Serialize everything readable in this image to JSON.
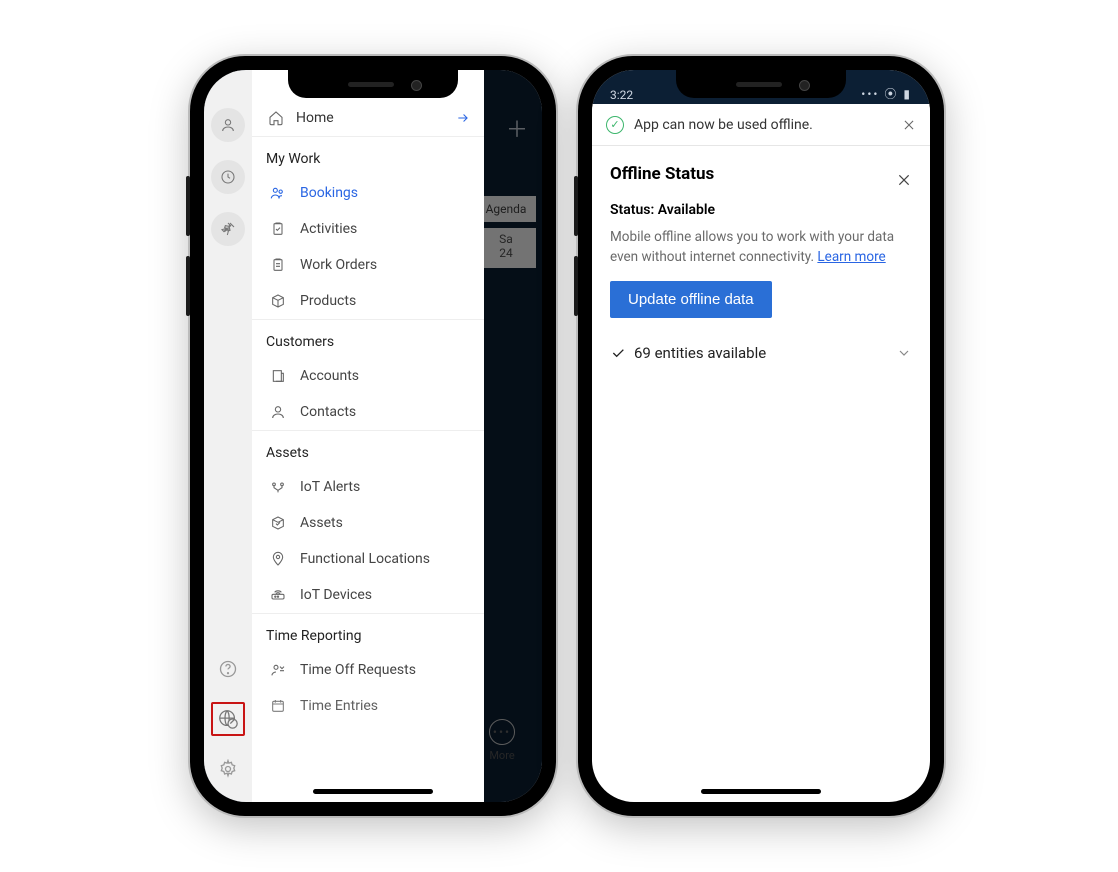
{
  "phone1": {
    "nav": {
      "home_label": "Home",
      "sections": {
        "mywork": {
          "title": "My Work",
          "items": [
            {
              "label": "Bookings",
              "selected": true,
              "icon": "people-icon"
            },
            {
              "label": "Activities",
              "icon": "clipboard-check-icon"
            },
            {
              "label": "Work Orders",
              "icon": "clipboard-icon"
            },
            {
              "label": "Products",
              "icon": "box-icon"
            }
          ]
        },
        "customers": {
          "title": "Customers",
          "items": [
            {
              "label": "Accounts",
              "icon": "document-icon"
            },
            {
              "label": "Contacts",
              "icon": "person-icon"
            }
          ]
        },
        "assets": {
          "title": "Assets",
          "items": [
            {
              "label": "IoT Alerts",
              "icon": "alert-icon"
            },
            {
              "label": "Assets",
              "icon": "box-check-icon"
            },
            {
              "label": "Functional Locations",
              "icon": "map-pin-icon"
            },
            {
              "label": "IoT Devices",
              "icon": "router-icon"
            }
          ]
        },
        "time": {
          "title": "Time Reporting",
          "items": [
            {
              "label": "Time Off Requests",
              "icon": "time-off-icon"
            },
            {
              "label": "Time Entries",
              "icon": "calendar-icon"
            }
          ]
        }
      }
    },
    "bg": {
      "agenda_tab": "Agenda",
      "day_label": "Sa",
      "day_num": "24",
      "more_label": "More"
    }
  },
  "phone2": {
    "status_time": "3:22",
    "toast": "App can now be used offline.",
    "title": "Offline Status",
    "status_line": "Status: Available",
    "description": "Mobile offline allows you to work with your data even without internet connectivity.",
    "learn_more": "Learn more",
    "button": "Update offline data",
    "entities": "69 entities available"
  }
}
